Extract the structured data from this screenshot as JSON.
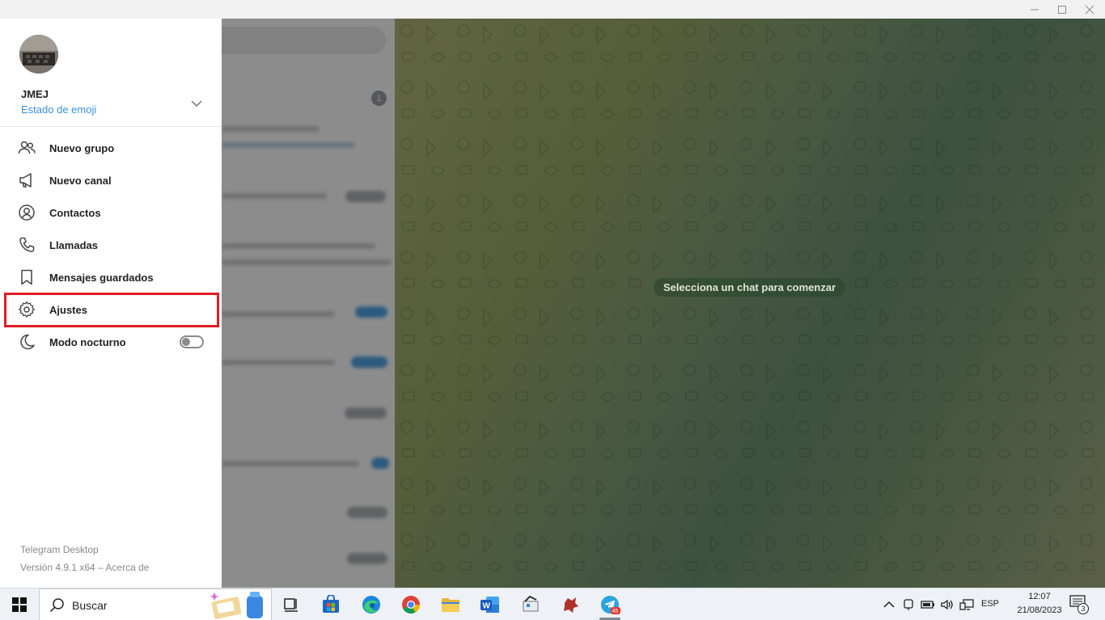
{
  "window": {
    "controls": {
      "minimize": "–",
      "maximize": "☐",
      "close": "✕"
    }
  },
  "chat_list": {
    "unread_badge": "1"
  },
  "chat_area": {
    "hint": "Selecciona un chat para comenzar"
  },
  "side_menu": {
    "user_name": "JMEJ",
    "emoji_status": "Estado de emoji",
    "items": [
      {
        "label": "Nuevo grupo",
        "icon": "group-icon"
      },
      {
        "label": "Nuevo canal",
        "icon": "megaphone-icon"
      },
      {
        "label": "Contactos",
        "icon": "contact-icon"
      },
      {
        "label": "Llamadas",
        "icon": "phone-icon"
      },
      {
        "label": "Mensajes guardados",
        "icon": "bookmark-icon"
      },
      {
        "label": "Ajustes",
        "icon": "gear-icon",
        "highlighted": true
      },
      {
        "label": "Modo nocturno",
        "icon": "moon-icon",
        "toggle": false
      }
    ],
    "app_name": "Telegram Desktop",
    "app_version": "Versión 4.9.1 x64 – Acerca de"
  },
  "taskbar": {
    "search_placeholder": "Buscar",
    "apps": [
      {
        "name": "task-view",
        "icon": "task-view-icon"
      },
      {
        "name": "microsoft-store",
        "icon": "store-icon"
      },
      {
        "name": "edge",
        "icon": "edge-icon"
      },
      {
        "name": "chrome",
        "icon": "chrome-icon"
      },
      {
        "name": "file-explorer",
        "icon": "folder-icon"
      },
      {
        "name": "word",
        "icon": "word-icon"
      },
      {
        "name": "app-7",
        "icon": "app-icon"
      },
      {
        "name": "app-8",
        "icon": "app-icon"
      },
      {
        "name": "telegram",
        "icon": "telegram-icon",
        "badge": "45",
        "active": true
      }
    ],
    "tray": {
      "language": "ESP",
      "time": "12:07",
      "date": "21/08/2023",
      "notification_count": "3"
    },
    "colors": {
      "accent": "#3a8fd4",
      "highlight": "#e01c24"
    }
  }
}
